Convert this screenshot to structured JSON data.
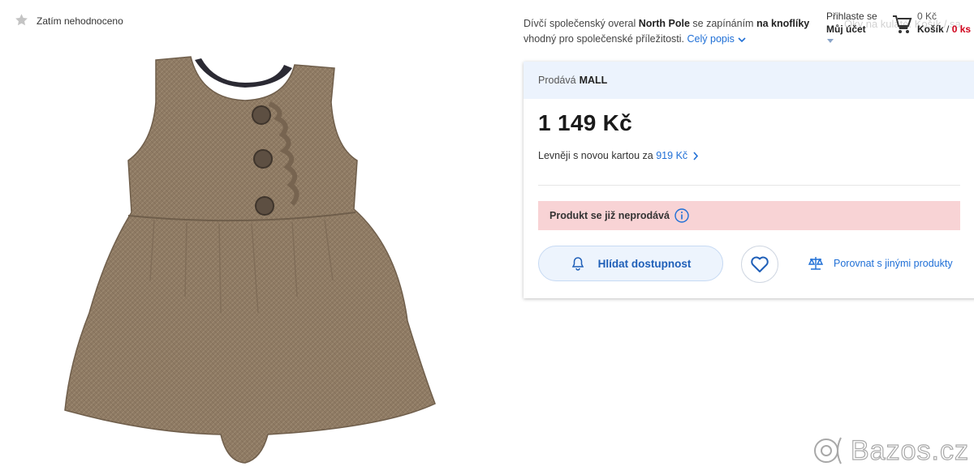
{
  "rating": {
    "text": "Zatím nehodnoceno",
    "icon": "star-icon"
  },
  "description": {
    "part1": "Dívčí společenský overal ",
    "brand": "North Pole",
    "part2": " se zapínáním ",
    "highlight": "na knoflíky",
    "line2": "vhodný pro společenské příležitosti.",
    "more_link": "Celý popis"
  },
  "account": {
    "login_label": "Přihlaste se",
    "account_label": "Můj účet"
  },
  "cart": {
    "sum": "0 Kč",
    "label": "Košík",
    "separator": " / ",
    "count": "0 ks"
  },
  "ghost_text": "Oky na kulaté. Košík / sa",
  "card": {
    "seller_prefix": "Prodává",
    "seller_name": "MALL",
    "price": "1 149 Kč",
    "cheaper_text": "Levněji s novou kartou za ",
    "cheaper_value": "919 Kč",
    "alert_text": "Produkt se již neprodává",
    "watch_button": "Hlídat dostupnost",
    "compare_link": "Porovnat s jinými produkty"
  },
  "watermark": {
    "text": "Bazos.cz"
  },
  "colors": {
    "accent": "#1f6fd6",
    "alert_bg": "#f8d3d5",
    "seller_bg": "#ecf3fd",
    "cart_count": "#d0021b"
  }
}
